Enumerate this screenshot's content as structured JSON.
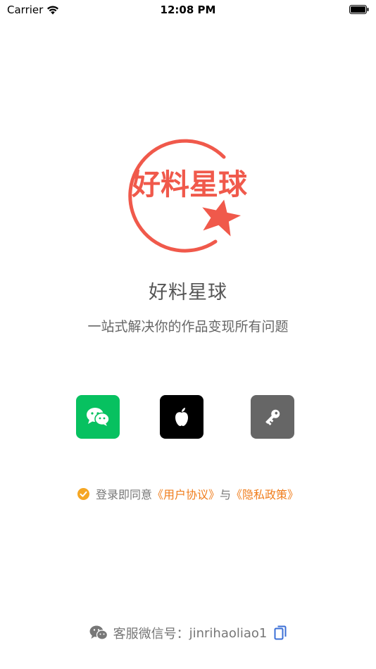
{
  "status_bar": {
    "carrier": "Carrier",
    "time": "12:08 PM"
  },
  "logo": {
    "text": "好料星球",
    "color": "#f0594b"
  },
  "app": {
    "name": "好料星球",
    "slogan": "一站式解决你的作品变现所有问题"
  },
  "login_options": [
    {
      "icon": "wechat-icon",
      "color": "#07c160"
    },
    {
      "icon": "apple-icon",
      "color": "#000000"
    },
    {
      "icon": "key-icon",
      "color": "#666666"
    }
  ],
  "agreement": {
    "checked": true,
    "prefix": "登录即同意",
    "user_agreement": "《用户协议》",
    "conjunction": "与",
    "privacy_policy": "《隐私政策》",
    "link_color": "#f07d1c"
  },
  "contact": {
    "label": "客服微信号：",
    "wechat_id": "jinrihaoliao1",
    "copy_icon": "copy-icon"
  }
}
